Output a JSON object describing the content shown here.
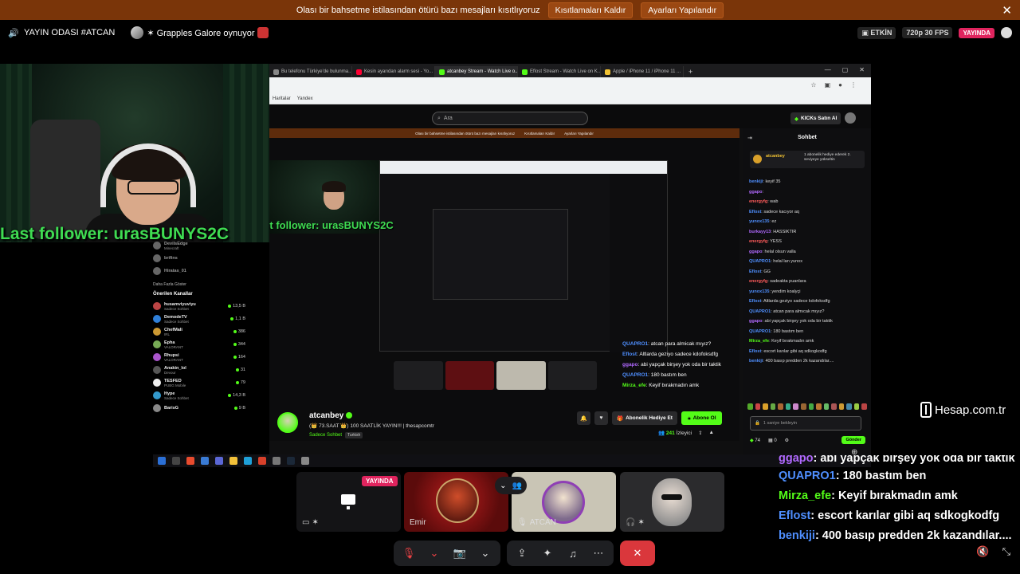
{
  "warning_bar": {
    "message": "Olası bir bahsetme istilasından ötürü bazı mesajları kısıtlıyoruz",
    "remove_restrictions": "Kısıtlamaları Kaldır",
    "adjust_settings": "Ayarları Yapılandır",
    "close": "✕"
  },
  "call_header": {
    "channel": "YAYIN ODASI #ATCAN",
    "activity": "✶ Grapples Galore oynuyor",
    "activity_status": "ETKİN",
    "quality": "720p 30 FPS",
    "live": "YAYINDA"
  },
  "webcam": {
    "follower_text": "Last follower: urasBUNYS2C"
  },
  "browser": {
    "tabs": [
      {
        "label": "Bu telefonu Türkiye'de bulunma...",
        "color": "#888888"
      },
      {
        "label": "Kesin ayarıdan alarm sesi - Yo...",
        "color": "#ff0033"
      },
      {
        "label": "atcanbey Stream - Watch Live o...",
        "color": "#53fc18"
      },
      {
        "label": "Eflost Stream - Watch Live on K...",
        "color": "#53fc18"
      },
      {
        "label": "Apple / iPhone 11 / iPhone 11 ...",
        "color": "#f1c232"
      }
    ],
    "bookmarks": [
      "Haritalar",
      "Yandex"
    ],
    "search_placeholder": "Ara",
    "kicks_button": "KICKs Satın Al"
  },
  "sidebar": {
    "top_items": [
      {
        "name": "DevilsEdge",
        "sub": "Minecraft"
      },
      {
        "name": "brifins",
        "sub": ""
      },
      {
        "name": "Hiratas_01",
        "sub": ""
      }
    ],
    "show_more": "Daha Fazla Göster",
    "recommended_title": "Önerilen Kanallar",
    "recommended": [
      {
        "name": "husamviyuviyu",
        "sub": "Sadece Sohbet",
        "count": "13,5 B"
      },
      {
        "name": "DemodeTV",
        "sub": "Sadece Sohbet",
        "count": "1,1 B"
      },
      {
        "name": "ChefMali",
        "sub": "IRL",
        "count": "386"
      },
      {
        "name": "Epha",
        "sub": "VALORANT",
        "count": "344"
      },
      {
        "name": "Rhupsi",
        "sub": "VALORANT",
        "count": "164"
      },
      {
        "name": "Anakin_lol",
        "sub": "Devour",
        "count": "31"
      },
      {
        "name": "TESFED",
        "sub": "PUBG Mobile",
        "count": "79"
      },
      {
        "name": "Hype",
        "sub": "Sadece Sohbet",
        "count": "14,3 B"
      },
      {
        "name": "BarisG",
        "sub": "",
        "count": "9 B"
      }
    ]
  },
  "nested_chat": [
    {
      "user": "QUAPRO1",
      "text": ": atcan para almicak mıyız?",
      "color": "#4f8fff"
    },
    {
      "user": "Eflost",
      "text": ": Altlarda geziyo sadece kdofoksdfg",
      "color": "#4f8fff"
    },
    {
      "user": "ggapo",
      "text": ": abi yapçak birşey yok oda bir taktik",
      "color": "#b169ff"
    },
    {
      "user": "QUAPRO1",
      "text": ": 180 bastım ben",
      "color": "#4f8fff"
    },
    {
      "user": "Mirza_efe",
      "text": ": Keyif bırakmadın amk",
      "color": "#53fc18"
    }
  ],
  "channel": {
    "name": "atcanbey",
    "title": "(👑 73.SAAT 👑) 100 SAATLİK YAYIN!!! | thesapcomtr",
    "category": "Sadece Sohbet",
    "language": "Turkish",
    "gift_sub": "Abonelik Hediye Et",
    "subscribe": "Abone Ol",
    "viewers": "241",
    "viewers_label": "İzleyici"
  },
  "chat_panel": {
    "title": "Sohbet",
    "pinned_user": "atcanbey",
    "pinned_text": "1 abonelik hediye ederek 2. seviyeye yükseltin",
    "messages": [
      {
        "user": "benkiji",
        "text": ": keyif 35",
        "color": "#4f8fff"
      },
      {
        "user": "ggapo",
        "text": ":",
        "color": "#b169ff"
      },
      {
        "user": "energyfg",
        "text": ": wab",
        "color": "#ff5b5b"
      },
      {
        "user": "Eflost",
        "text": ": sadece kacıyor aq",
        "color": "#4f8fff"
      },
      {
        "user": "yunox135",
        "text": ": ez",
        "color": "#4f8fff"
      },
      {
        "user": "burkayy13",
        "text": ": HASSİKTİR",
        "color": "#b169ff"
      },
      {
        "user": "energyfg",
        "text": ": YESS",
        "color": "#ff5b5b"
      },
      {
        "user": "ggapo",
        "text": ": helal olsun valla",
        "color": "#b169ff"
      },
      {
        "user": "QUAPRO1",
        "text": ": helal lan yunox",
        "color": "#4f8fff"
      },
      {
        "user": "Eflost",
        "text": ": GG",
        "color": "#4f8fff"
      },
      {
        "user": "energyfg",
        "text": ": sadeakta puanlara",
        "color": "#ff5b5b"
      },
      {
        "user": "yunox135",
        "text": ": yendim koalyçi",
        "color": "#4f8fff"
      },
      {
        "user": "Eflost",
        "text": ": Altlarda geziyo sadece kdofoksdfg",
        "color": "#4f8fff"
      },
      {
        "user": "QUAPRO1",
        "text": ": atcan para almıcak mıyız?",
        "color": "#4f8fff"
      },
      {
        "user": "ggapo",
        "text": ": abi yapçak birşey yok oda bir taktik",
        "color": "#b169ff"
      },
      {
        "user": "QUAPRO1",
        "text": ": 180 bastım ben",
        "color": "#4f8fff"
      },
      {
        "user": "Mirza_efe",
        "text": ": Keyif bırakmadın amk",
        "color": "#53fc18"
      },
      {
        "user": "Eflost",
        "text": ": escort karılar gibi aq sdkogkodfg",
        "color": "#4f8fff"
      },
      {
        "user": "benkiji",
        "text": ": 400 basıp predden 2k kazandılar....",
        "color": "#4f8fff"
      }
    ],
    "input_placeholder": "1 saniye bekleyin",
    "points": "74",
    "count": "0",
    "send": "Gönder"
  },
  "watermark": "Hesap.com.tr",
  "overlay_chat": [
    {
      "user": "ggapo",
      "text": ": abi yapçak birşey yok oda bir taktik",
      "color": "#b169ff"
    },
    {
      "user": "QUAPRO1",
      "text": ": 180 bastım ben",
      "color": "#4f8fff"
    },
    {
      "user": "Mirza_efe",
      "text": ": Keyif bırakmadın amk",
      "color": "#53fc18"
    },
    {
      "user": "Eflost",
      "text": ": escort karılar gibi aq sdkogkodfg",
      "color": "#4f8fff"
    },
    {
      "user": "benkiji",
      "text": ": 400 basıp predden 2k kazandılar....",
      "color": "#4f8fff"
    }
  ],
  "participants": {
    "screen_live": "YAYINDA",
    "emir": "Emir",
    "atcan": "ATCAN"
  }
}
